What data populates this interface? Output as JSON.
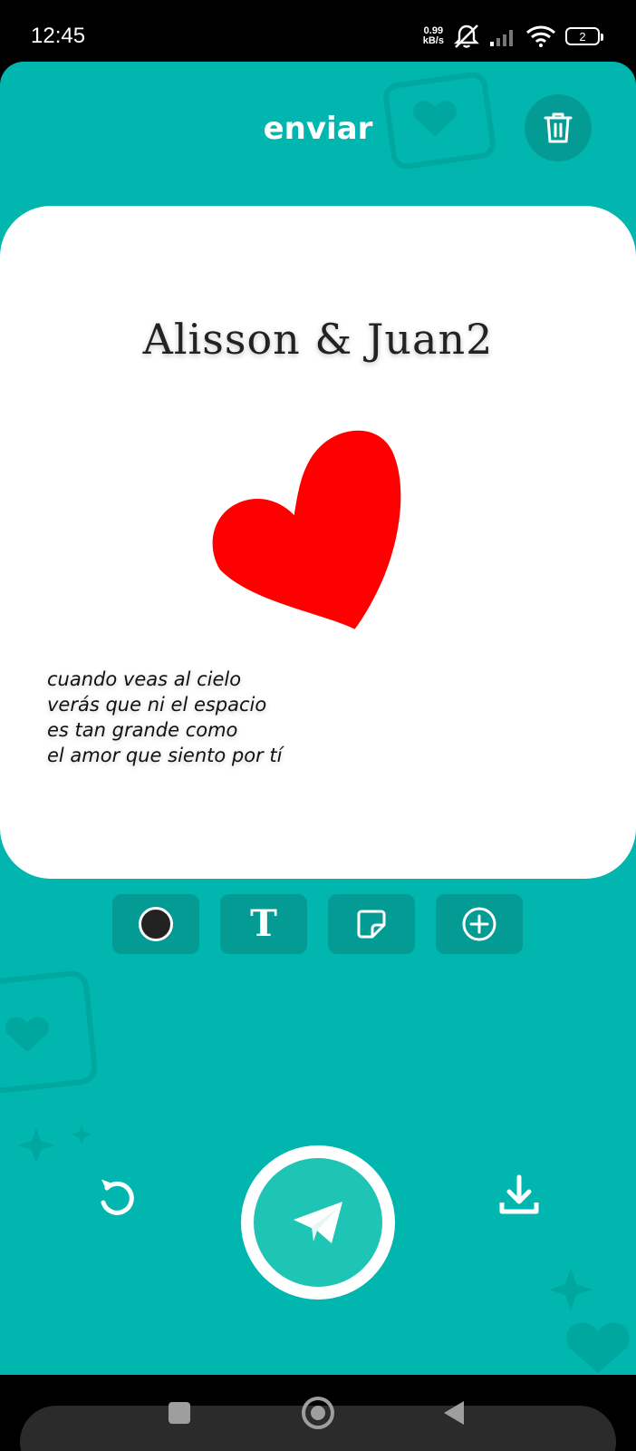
{
  "status_bar": {
    "time": "12:45",
    "net_speed_value": "0.99",
    "net_speed_unit": "kB/s",
    "battery_level": "2",
    "icons": [
      "mute-icon",
      "signal-icon",
      "wifi-icon",
      "battery-icon"
    ]
  },
  "header": {
    "title": "enviar",
    "trash_icon": "trash-icon"
  },
  "card": {
    "title": "Alisson & Juan2",
    "sticker_icon": "heart-icon",
    "sticker_color": "#ff0000",
    "poem_lines": [
      "cuando veas al cielo",
      "verás que ni el espacio",
      "es tan grande como",
      "el amor que siento por tí"
    ]
  },
  "tools": [
    {
      "name": "color-tool",
      "icon": "color-dot-icon"
    },
    {
      "name": "text-tool",
      "icon": "text-icon",
      "glyph": "T"
    },
    {
      "name": "sticker-tool",
      "icon": "sticker-icon"
    },
    {
      "name": "add-tool",
      "icon": "plus-circle-icon"
    }
  ],
  "actions": {
    "undo_icon": "undo-icon",
    "send_icon": "send-icon",
    "download_icon": "download-icon"
  },
  "colors": {
    "background": "#00b6ae",
    "button_dark": "#049b94",
    "send_fill": "#1fc5b4",
    "card": "#ffffff",
    "heart": "#ff0000"
  }
}
